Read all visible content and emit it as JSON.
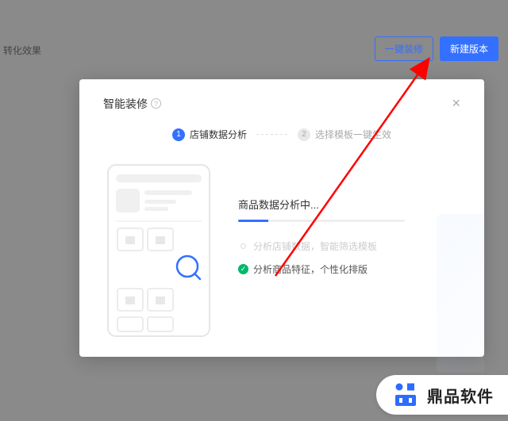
{
  "page": {
    "top_label": "转化效果",
    "btn_outline": "一键装修",
    "btn_primary": "新建版本"
  },
  "modal": {
    "title": "智能装修",
    "step1": "店铺数据分析",
    "step2": "选择模板一键生效",
    "progress_label": "商品数据分析中...",
    "task_pending": "分析店铺数据，智能筛选模板",
    "task_done": "分析商品特征，个性化排版"
  },
  "brand": {
    "name": "鼎品软件"
  }
}
